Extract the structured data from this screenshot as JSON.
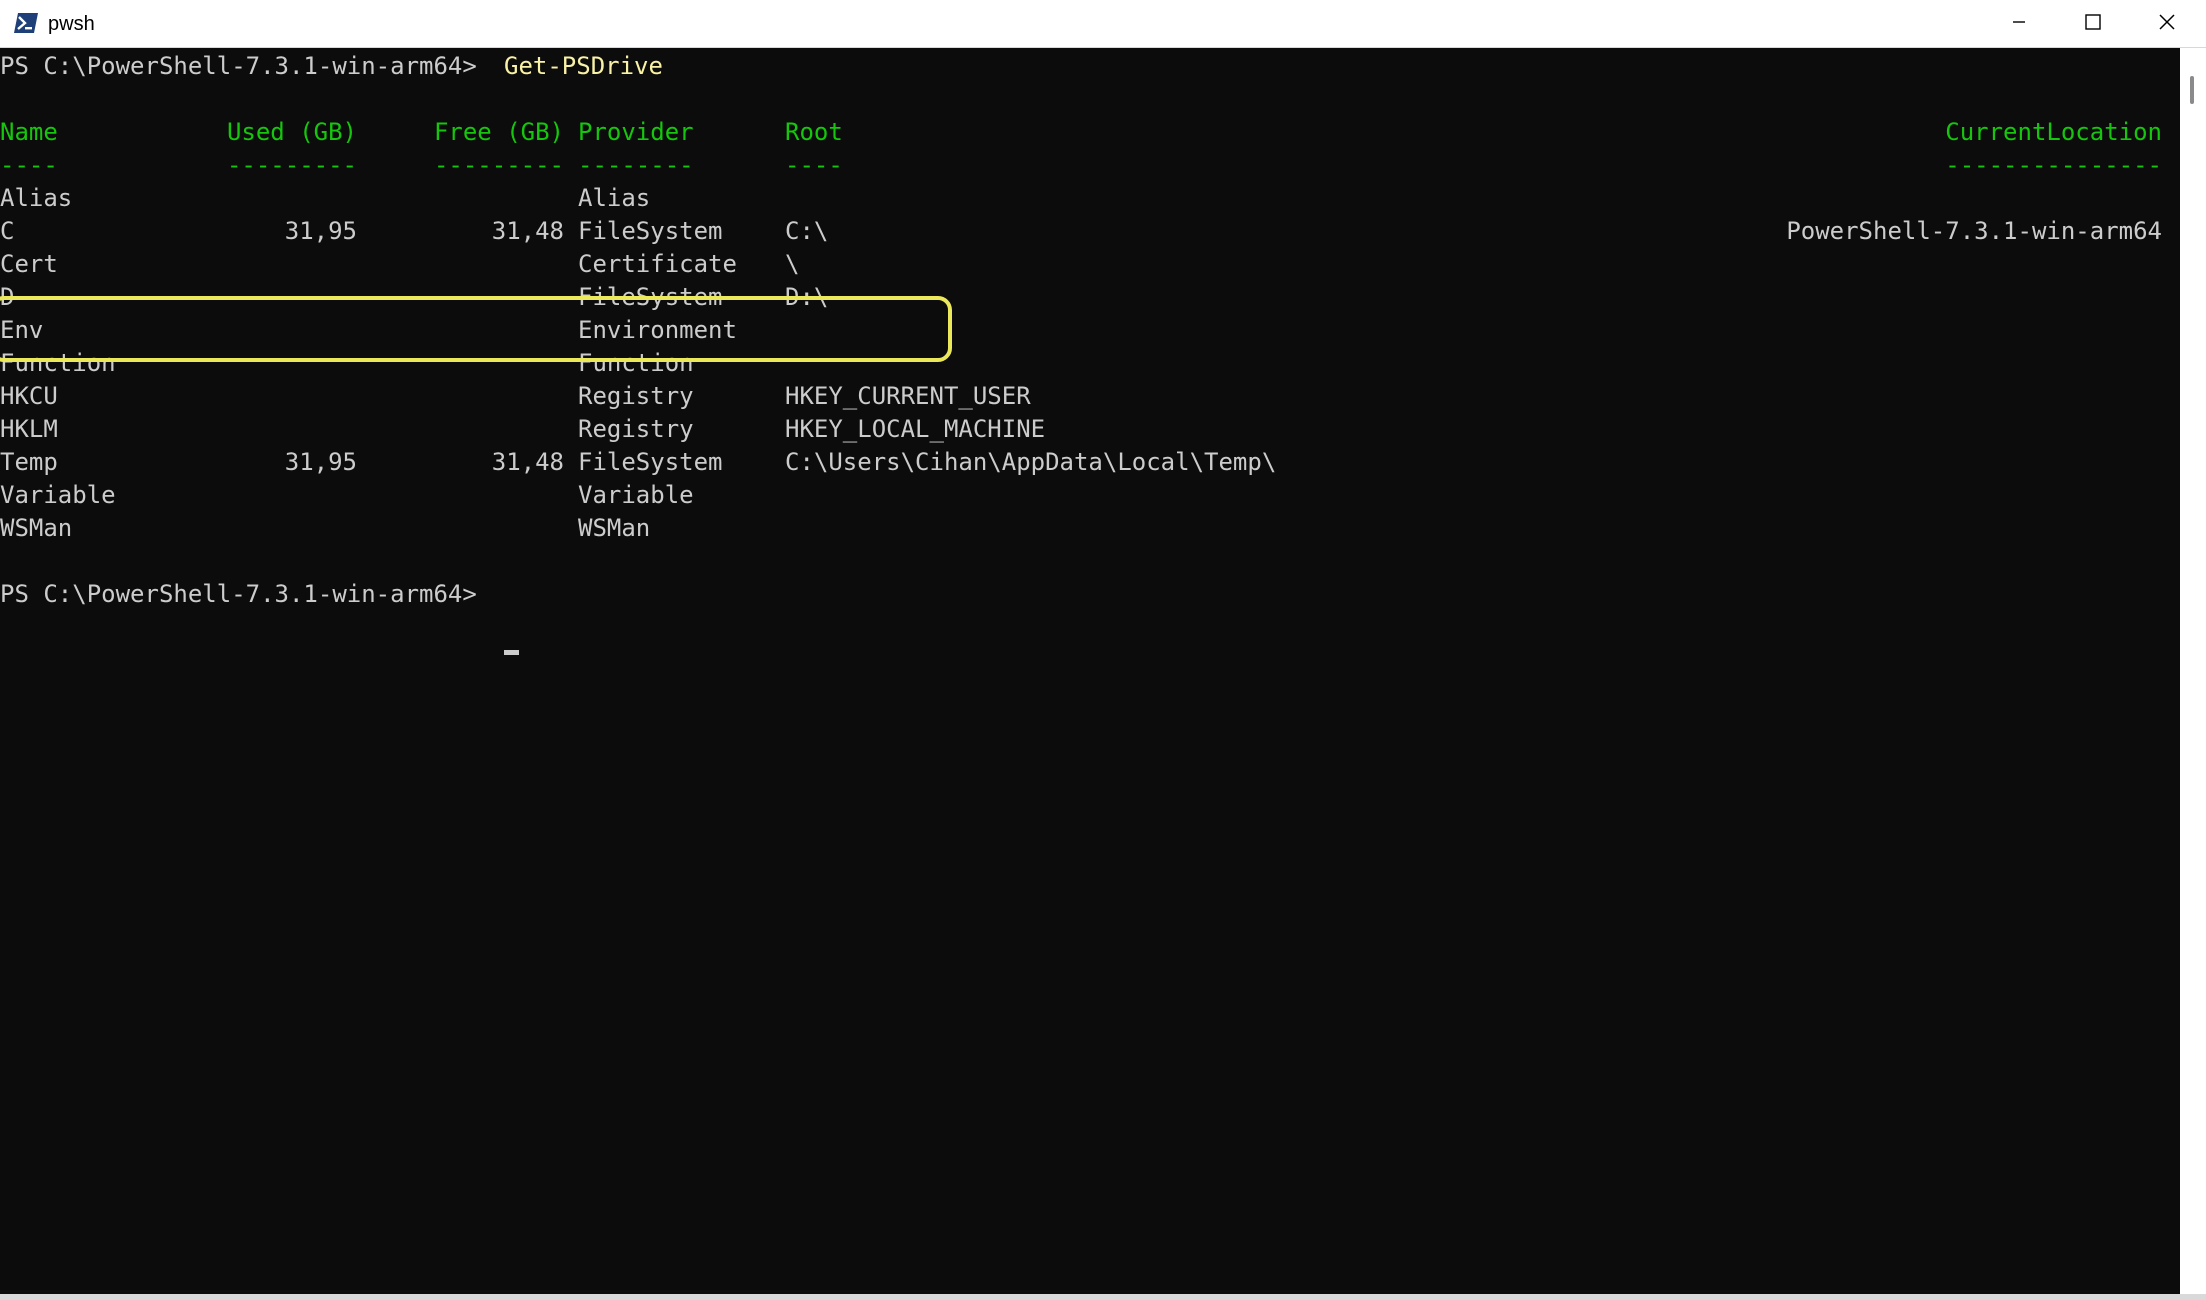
{
  "window": {
    "title": "pwsh",
    "icon": "powershell-icon",
    "controls": [
      "minimize-icon",
      "maximize-icon",
      "close-icon"
    ]
  },
  "console": {
    "prompt1": "PS C:\\PowerShell-7.3.1-win-arm64>",
    "command": "Get-PSDrive",
    "headers": {
      "name": "Name",
      "used": "Used (GB)",
      "free": "Free (GB)",
      "provider": "Provider",
      "root": "Root",
      "current_location": "CurrentLocation"
    },
    "separators": {
      "name": "----",
      "used": "---------",
      "free": "---------",
      "provider": "--------",
      "root": "----",
      "current_location": "---------------"
    },
    "rows": [
      {
        "name": "Alias",
        "used": "",
        "free": "",
        "provider": "Alias",
        "root": "",
        "current_location": ""
      },
      {
        "name": "C",
        "used": "31,95",
        "free": "31,48",
        "provider": "FileSystem",
        "root": "C:\\",
        "current_location": "PowerShell-7.3.1-win-arm64"
      },
      {
        "name": "Cert",
        "used": "",
        "free": "",
        "provider": "Certificate",
        "root": "\\",
        "current_location": ""
      },
      {
        "name": "D",
        "used": "",
        "free": "",
        "provider": "FileSystem",
        "root": "D:\\",
        "current_location": ""
      },
      {
        "name": "Env",
        "used": "",
        "free": "",
        "provider": "Environment",
        "root": "",
        "current_location": ""
      },
      {
        "name": "Function",
        "used": "",
        "free": "",
        "provider": "Function",
        "root": "",
        "current_location": ""
      },
      {
        "name": "HKCU",
        "used": "",
        "free": "",
        "provider": "Registry",
        "root": "HKEY_CURRENT_USER",
        "current_location": ""
      },
      {
        "name": "HKLM",
        "used": "",
        "free": "",
        "provider": "Registry",
        "root": "HKEY_LOCAL_MACHINE",
        "current_location": ""
      },
      {
        "name": "Temp",
        "used": "31,95",
        "free": "31,48",
        "provider": "FileSystem",
        "root": "C:\\Users\\Cihan\\AppData\\Local\\Temp\\",
        "current_location": ""
      },
      {
        "name": "Variable",
        "used": "",
        "free": "",
        "provider": "Variable",
        "root": "",
        "current_location": ""
      },
      {
        "name": "WSMan",
        "used": "",
        "free": "",
        "provider": "WSMan",
        "root": "",
        "current_location": ""
      }
    ],
    "prompt2": "PS C:\\PowerShell-7.3.1-win-arm64>",
    "highlighted_row": "Env"
  },
  "colors": {
    "background": "#0c0c0c",
    "foreground": "#cccccc",
    "header": "#16c60c",
    "command": "#f9f1a5",
    "highlight": "#ece85c"
  }
}
